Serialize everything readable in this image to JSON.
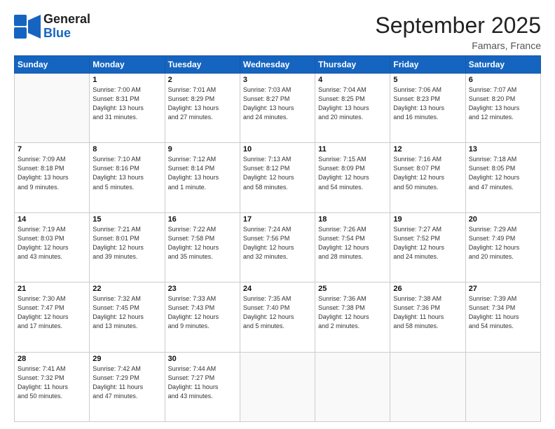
{
  "header": {
    "logo_line1": "General",
    "logo_line2": "Blue",
    "month": "September 2025",
    "location": "Famars, France"
  },
  "days_of_week": [
    "Sunday",
    "Monday",
    "Tuesday",
    "Wednesday",
    "Thursday",
    "Friday",
    "Saturday"
  ],
  "weeks": [
    [
      {
        "day": "",
        "info": ""
      },
      {
        "day": "1",
        "info": "Sunrise: 7:00 AM\nSunset: 8:31 PM\nDaylight: 13 hours\nand 31 minutes."
      },
      {
        "day": "2",
        "info": "Sunrise: 7:01 AM\nSunset: 8:29 PM\nDaylight: 13 hours\nand 27 minutes."
      },
      {
        "day": "3",
        "info": "Sunrise: 7:03 AM\nSunset: 8:27 PM\nDaylight: 13 hours\nand 24 minutes."
      },
      {
        "day": "4",
        "info": "Sunrise: 7:04 AM\nSunset: 8:25 PM\nDaylight: 13 hours\nand 20 minutes."
      },
      {
        "day": "5",
        "info": "Sunrise: 7:06 AM\nSunset: 8:23 PM\nDaylight: 13 hours\nand 16 minutes."
      },
      {
        "day": "6",
        "info": "Sunrise: 7:07 AM\nSunset: 8:20 PM\nDaylight: 13 hours\nand 12 minutes."
      }
    ],
    [
      {
        "day": "7",
        "info": "Sunrise: 7:09 AM\nSunset: 8:18 PM\nDaylight: 13 hours\nand 9 minutes."
      },
      {
        "day": "8",
        "info": "Sunrise: 7:10 AM\nSunset: 8:16 PM\nDaylight: 13 hours\nand 5 minutes."
      },
      {
        "day": "9",
        "info": "Sunrise: 7:12 AM\nSunset: 8:14 PM\nDaylight: 13 hours\nand 1 minute."
      },
      {
        "day": "10",
        "info": "Sunrise: 7:13 AM\nSunset: 8:12 PM\nDaylight: 12 hours\nand 58 minutes."
      },
      {
        "day": "11",
        "info": "Sunrise: 7:15 AM\nSunset: 8:09 PM\nDaylight: 12 hours\nand 54 minutes."
      },
      {
        "day": "12",
        "info": "Sunrise: 7:16 AM\nSunset: 8:07 PM\nDaylight: 12 hours\nand 50 minutes."
      },
      {
        "day": "13",
        "info": "Sunrise: 7:18 AM\nSunset: 8:05 PM\nDaylight: 12 hours\nand 47 minutes."
      }
    ],
    [
      {
        "day": "14",
        "info": "Sunrise: 7:19 AM\nSunset: 8:03 PM\nDaylight: 12 hours\nand 43 minutes."
      },
      {
        "day": "15",
        "info": "Sunrise: 7:21 AM\nSunset: 8:01 PM\nDaylight: 12 hours\nand 39 minutes."
      },
      {
        "day": "16",
        "info": "Sunrise: 7:22 AM\nSunset: 7:58 PM\nDaylight: 12 hours\nand 35 minutes."
      },
      {
        "day": "17",
        "info": "Sunrise: 7:24 AM\nSunset: 7:56 PM\nDaylight: 12 hours\nand 32 minutes."
      },
      {
        "day": "18",
        "info": "Sunrise: 7:26 AM\nSunset: 7:54 PM\nDaylight: 12 hours\nand 28 minutes."
      },
      {
        "day": "19",
        "info": "Sunrise: 7:27 AM\nSunset: 7:52 PM\nDaylight: 12 hours\nand 24 minutes."
      },
      {
        "day": "20",
        "info": "Sunrise: 7:29 AM\nSunset: 7:49 PM\nDaylight: 12 hours\nand 20 minutes."
      }
    ],
    [
      {
        "day": "21",
        "info": "Sunrise: 7:30 AM\nSunset: 7:47 PM\nDaylight: 12 hours\nand 17 minutes."
      },
      {
        "day": "22",
        "info": "Sunrise: 7:32 AM\nSunset: 7:45 PM\nDaylight: 12 hours\nand 13 minutes."
      },
      {
        "day": "23",
        "info": "Sunrise: 7:33 AM\nSunset: 7:43 PM\nDaylight: 12 hours\nand 9 minutes."
      },
      {
        "day": "24",
        "info": "Sunrise: 7:35 AM\nSunset: 7:40 PM\nDaylight: 12 hours\nand 5 minutes."
      },
      {
        "day": "25",
        "info": "Sunrise: 7:36 AM\nSunset: 7:38 PM\nDaylight: 12 hours\nand 2 minutes."
      },
      {
        "day": "26",
        "info": "Sunrise: 7:38 AM\nSunset: 7:36 PM\nDaylight: 11 hours\nand 58 minutes."
      },
      {
        "day": "27",
        "info": "Sunrise: 7:39 AM\nSunset: 7:34 PM\nDaylight: 11 hours\nand 54 minutes."
      }
    ],
    [
      {
        "day": "28",
        "info": "Sunrise: 7:41 AM\nSunset: 7:32 PM\nDaylight: 11 hours\nand 50 minutes."
      },
      {
        "day": "29",
        "info": "Sunrise: 7:42 AM\nSunset: 7:29 PM\nDaylight: 11 hours\nand 47 minutes."
      },
      {
        "day": "30",
        "info": "Sunrise: 7:44 AM\nSunset: 7:27 PM\nDaylight: 11 hours\nand 43 minutes."
      },
      {
        "day": "",
        "info": ""
      },
      {
        "day": "",
        "info": ""
      },
      {
        "day": "",
        "info": ""
      },
      {
        "day": "",
        "info": ""
      }
    ]
  ]
}
